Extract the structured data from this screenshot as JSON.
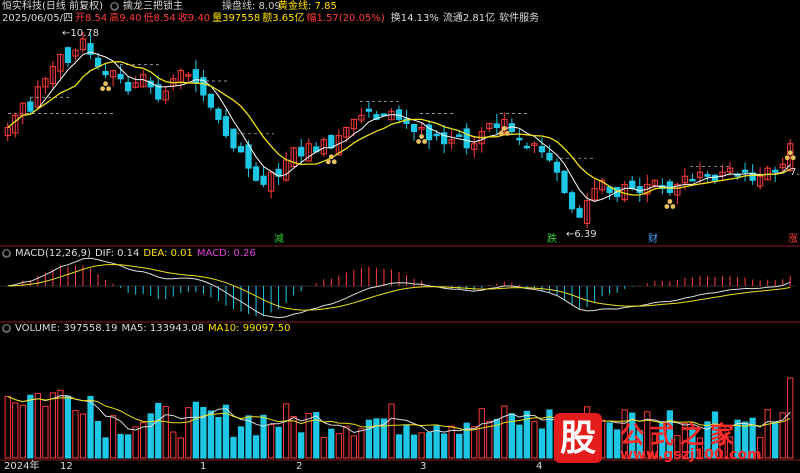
{
  "colors": {
    "up": "#ff3b3b",
    "down": "#1fc7e6",
    "ma5": "#ffffff",
    "ma10": "#f0e020",
    "grid": "#8b1a1a",
    "label_gray": "#bbbbbb",
    "red": "#ff3b3b",
    "yellow": "#ffe000",
    "purple": "#e040e0",
    "green": "#2fd02f",
    "macd_axis": "#aaaaaa"
  },
  "header": {
    "title": "恒实科技(日线 前复权)",
    "indicator": "擒龙三把锁主",
    "date": "2025/06/05/四",
    "open": "开8.54",
    "high": "高9.40",
    "low": "低8.54",
    "close": "收9.40",
    "volume": "量397558",
    "amount": "额3.65亿",
    "change": "幅1.57(20.05%)",
    "turnover": "换14.13%",
    "float": "流通2.81亿",
    "sector": "软件服务",
    "line1_label": "操盘线: 8.09",
    "line2_label": "黄金线: 7.85"
  },
  "price_panel": {
    "max_label": "10.78",
    "min_label": "6.39",
    "right_label": "7.",
    "markers": [
      {
        "text": "减",
        "color": "#2fd02f"
      },
      {
        "text": "跌",
        "color": "#2fd02f"
      },
      {
        "text": "财",
        "color": "#4aa0ff"
      },
      {
        "text": "涨",
        "color": "#ff3b3b"
      }
    ]
  },
  "macd_panel": {
    "title": "MACD(12,26,9)",
    "dif": "DIF: 0.14",
    "dea": "DEA: 0.01",
    "macd": "MACD: 0.26"
  },
  "volume_panel": {
    "title": "VOLUME: 397558.19",
    "ma5": "MA5: 133943.08",
    "ma10": "MA10: 99097.50"
  },
  "time_axis": [
    "2024年",
    "12",
    "1",
    "2",
    "3",
    "4"
  ],
  "watermark": {
    "text": "公式之家",
    "url": "www.gszj100.com",
    "logo": "股"
  },
  "chart_data": {
    "type": "candlestick",
    "closes": [
      8.6,
      8.9,
      9.2,
      9.0,
      9.6,
      9.8,
      10.1,
      10.4,
      10.2,
      10.5,
      10.78,
      10.4,
      10.1,
      9.9,
      10.0,
      9.8,
      9.5,
      9.7,
      9.9,
      9.6,
      9.3,
      9.5,
      9.8,
      10.0,
      9.9,
      9.7,
      9.4,
      9.1,
      8.8,
      8.4,
      8.1,
      8.0,
      7.6,
      7.3,
      7.2,
      7.5,
      7.4,
      7.8,
      8.1,
      7.9,
      8.2,
      8.0,
      8.3,
      8.1,
      8.4,
      8.6,
      8.8,
      8.9,
      9.0,
      8.8,
      8.9,
      9.0,
      8.8,
      8.7,
      8.5,
      8.6,
      8.3,
      8.4,
      8.2,
      8.3,
      8.4,
      8.1,
      8.2,
      8.5,
      8.7,
      8.6,
      8.8,
      8.5,
      8.3,
      8.1,
      8.2,
      8.0,
      7.8,
      7.5,
      7.0,
      6.6,
      6.39,
      6.8,
      7.1,
      7.3,
      7.0,
      6.9,
      7.2,
      7.1,
      7.0,
      7.2,
      7.3,
      7.1,
      7.0,
      7.2,
      7.4,
      7.3,
      7.5,
      7.4,
      7.3,
      7.5,
      7.6,
      7.4,
      7.5,
      7.3,
      7.4,
      7.6,
      7.5,
      7.7,
      8.2
    ]
  }
}
